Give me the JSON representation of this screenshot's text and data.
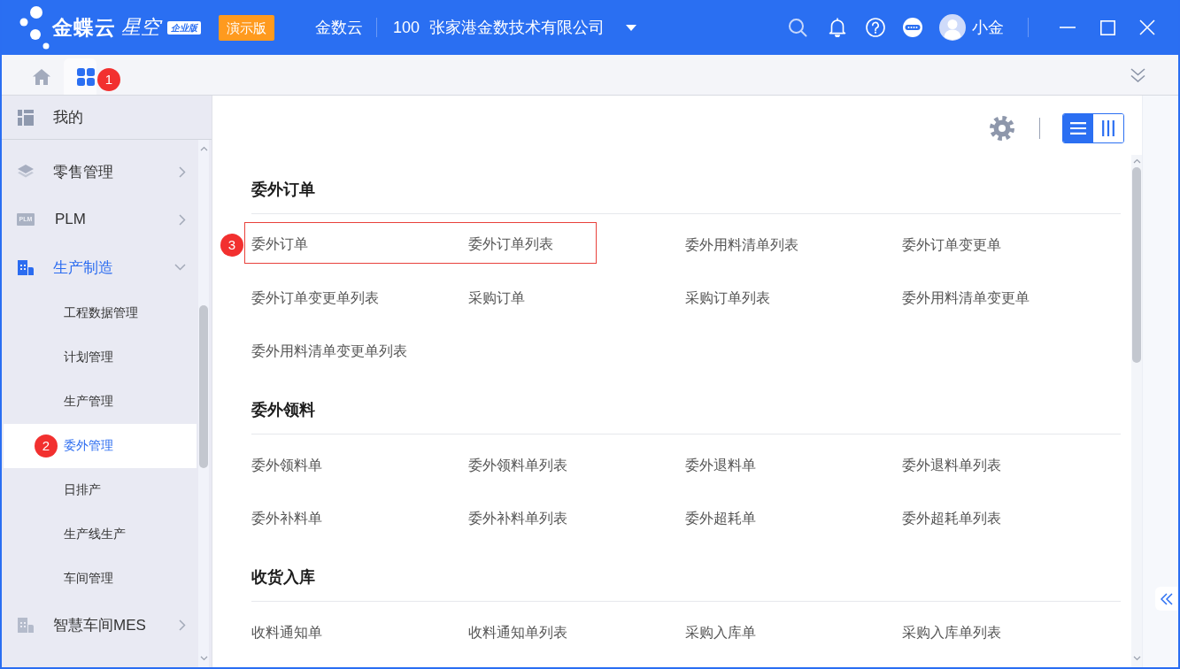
{
  "header": {
    "brand": "金蝶云",
    "product": "星空",
    "edition": "企业版",
    "demo_badge": "演示版",
    "tenant": "金数云",
    "org_code": "100",
    "org_name": "张家港金数技术有限公司",
    "user": "小金"
  },
  "tabs": [
    {
      "kind": "home",
      "selected": false
    },
    {
      "kind": "apps",
      "selected": true,
      "callout": "1"
    }
  ],
  "sidebar": {
    "pinned": {
      "label": "我的"
    },
    "items": [
      {
        "kind": "stack",
        "label": "零售管理",
        "expanded": false
      },
      {
        "kind": "logo",
        "logo_text": "PLM",
        "label": "PLM",
        "expanded": false
      },
      {
        "kind": "building",
        "label": "生产制造",
        "expanded": true,
        "children": [
          {
            "label": "工程数据管理",
            "selected": false
          },
          {
            "label": "计划管理",
            "selected": false
          },
          {
            "label": "生产管理",
            "selected": false
          },
          {
            "label": "委外管理",
            "selected": true,
            "callout": "2"
          },
          {
            "label": "日排产",
            "selected": false
          },
          {
            "label": "生产线生产",
            "selected": false
          },
          {
            "label": "车间管理",
            "selected": false
          }
        ]
      },
      {
        "kind": "building",
        "label": "智慧车间MES",
        "expanded": false
      }
    ]
  },
  "content": {
    "view_modes": [
      {
        "kind": "list",
        "selected": true
      },
      {
        "kind": "columns",
        "selected": false
      }
    ],
    "sections": [
      {
        "title": "委外订单",
        "framed": {
          "callout": "3",
          "links": [
            "委外订单",
            "委外订单列表"
          ]
        },
        "links": [
          "委外用料清单列表",
          "委外订单变更单",
          "委外订单变更单列表",
          "采购订单",
          "采购订单列表",
          "委外用料清单变更单",
          "委外用料清单变更单列表"
        ]
      },
      {
        "title": "委外领料",
        "links": [
          "委外领料单",
          "委外领料单列表",
          "委外退料单",
          "委外退料单列表",
          "委外补料单",
          "委外补料单列表",
          "委外超耗单",
          "委外超耗单列表"
        ]
      },
      {
        "title": "收货入库",
        "links": [
          "收料通知单",
          "收料通知单列表",
          "采购入库单",
          "采购入库单列表"
        ]
      }
    ]
  }
}
